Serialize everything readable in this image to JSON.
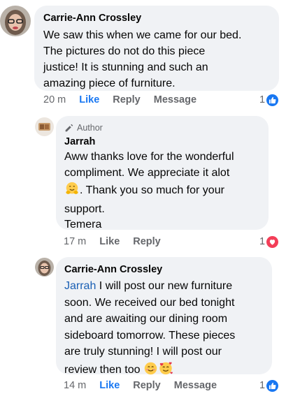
{
  "comments": [
    {
      "author": "Carrie-Ann Crossley",
      "lines": [
        "We saw this when we came for our bed.",
        "The pictures do not do this piece",
        "justice! It is stunning and such an",
        "amazing piece of furniture."
      ],
      "time": "20 m",
      "like_label": "Like",
      "reply_label": "Reply",
      "message_label": "Message",
      "reaction_count": "1",
      "reaction_type": "like-icon"
    },
    {
      "badge": "Author",
      "author": "Jarrah",
      "lines": [
        "Aww thanks love for the wonderful",
        "compliment. We appreciate it alot",
        ". Thank you so much for your",
        "support.",
        "Temera"
      ],
      "time": "17 m",
      "like_label": "Like",
      "reply_label": "Reply",
      "reaction_count": "1",
      "reaction_type": "love-icon"
    },
    {
      "author": "Carrie-Ann Crossley",
      "mention": "Jarrah",
      "lines": [
        " I will post our new furniture",
        "soon. We received our bed tonight",
        "and are awaiting our dining room",
        "sideboard tomorrow.  These pieces",
        "are truly stunning! I will post our",
        "review then too"
      ],
      "time": "14 m",
      "like_label": "Like",
      "reply_label": "Reply",
      "message_label": "Message",
      "reaction_count": "1",
      "reaction_type": "like-icon"
    }
  ],
  "colors": {
    "bubble": "#f0f2f5",
    "like_blue": "#1877f2",
    "love_red": "#f33e58",
    "meta_gray": "#65676b"
  }
}
